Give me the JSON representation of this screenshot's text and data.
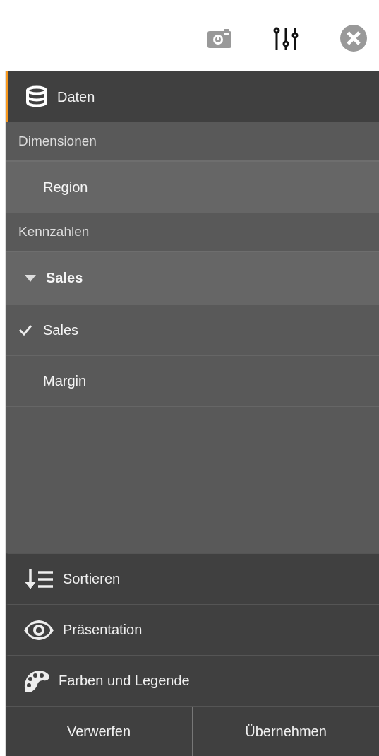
{
  "accordion": [
    {
      "kind": "data",
      "label": "Daten",
      "selected": true,
      "dimensions": {
        "heading": "Dimensionen",
        "items": [
          {
            "label": "Region"
          }
        ]
      },
      "measures": {
        "heading": "Kennzahlen",
        "items": [
          {
            "label": "Sales",
            "expanded": true,
            "children": [
              {
                "label": "Sales",
                "checked": true
              },
              {
                "label": "Margin",
                "checked": false
              }
            ]
          }
        ]
      }
    },
    {
      "kind": "sort",
      "label": "Sortieren",
      "selected": false
    },
    {
      "kind": "presentation",
      "label": "Präsentation",
      "selected": false
    },
    {
      "kind": "colors",
      "label": "Farben und Legende",
      "selected": false
    }
  ],
  "buttons": [
    {
      "label": "Verwerfen"
    },
    {
      "label": "Übernehmen"
    }
  ]
}
